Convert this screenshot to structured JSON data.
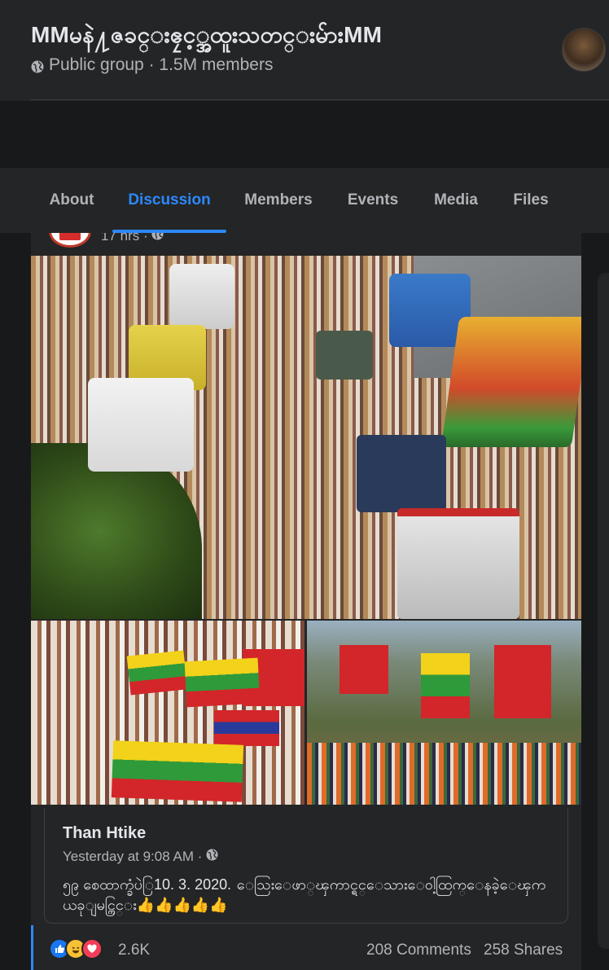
{
  "group": {
    "title": "MMမနဲ႔ဇခင္းဧၠင့္အထူးသတင္းမ်ားMM",
    "meta": "Public group · 1.5M members"
  },
  "tabs": [
    {
      "label": "About"
    },
    {
      "label": "Discussion",
      "active": true
    },
    {
      "label": "Members"
    },
    {
      "label": "Events"
    },
    {
      "label": "Media"
    },
    {
      "label": "Files"
    }
  ],
  "post": {
    "time": "17 hrs ·",
    "shared": {
      "author": "Than Htike",
      "time": "Yesterday at 9:08 AM ·",
      "text": "၅၉ စေထာက္ခံပဲြ10. 3.  2020. ေသြးေဖာ္ၾကာင္ရင္ေသားေဝါ့ထြက္ေနခဲ့ေၾက ယခုျမင္ကြင္း👍👍👍👍👍"
    },
    "reactions": {
      "icons": [
        "like-icon",
        "haha-icon",
        "love-icon"
      ],
      "count": "2.6K"
    },
    "comments": "208 Comments",
    "shares": "258 Shares"
  },
  "colors": {
    "accent": "#2d88ff",
    "background": "#18191a",
    "surface": "#242526",
    "text_primary": "#e4e6eb",
    "text_secondary": "#b0b3b8"
  }
}
